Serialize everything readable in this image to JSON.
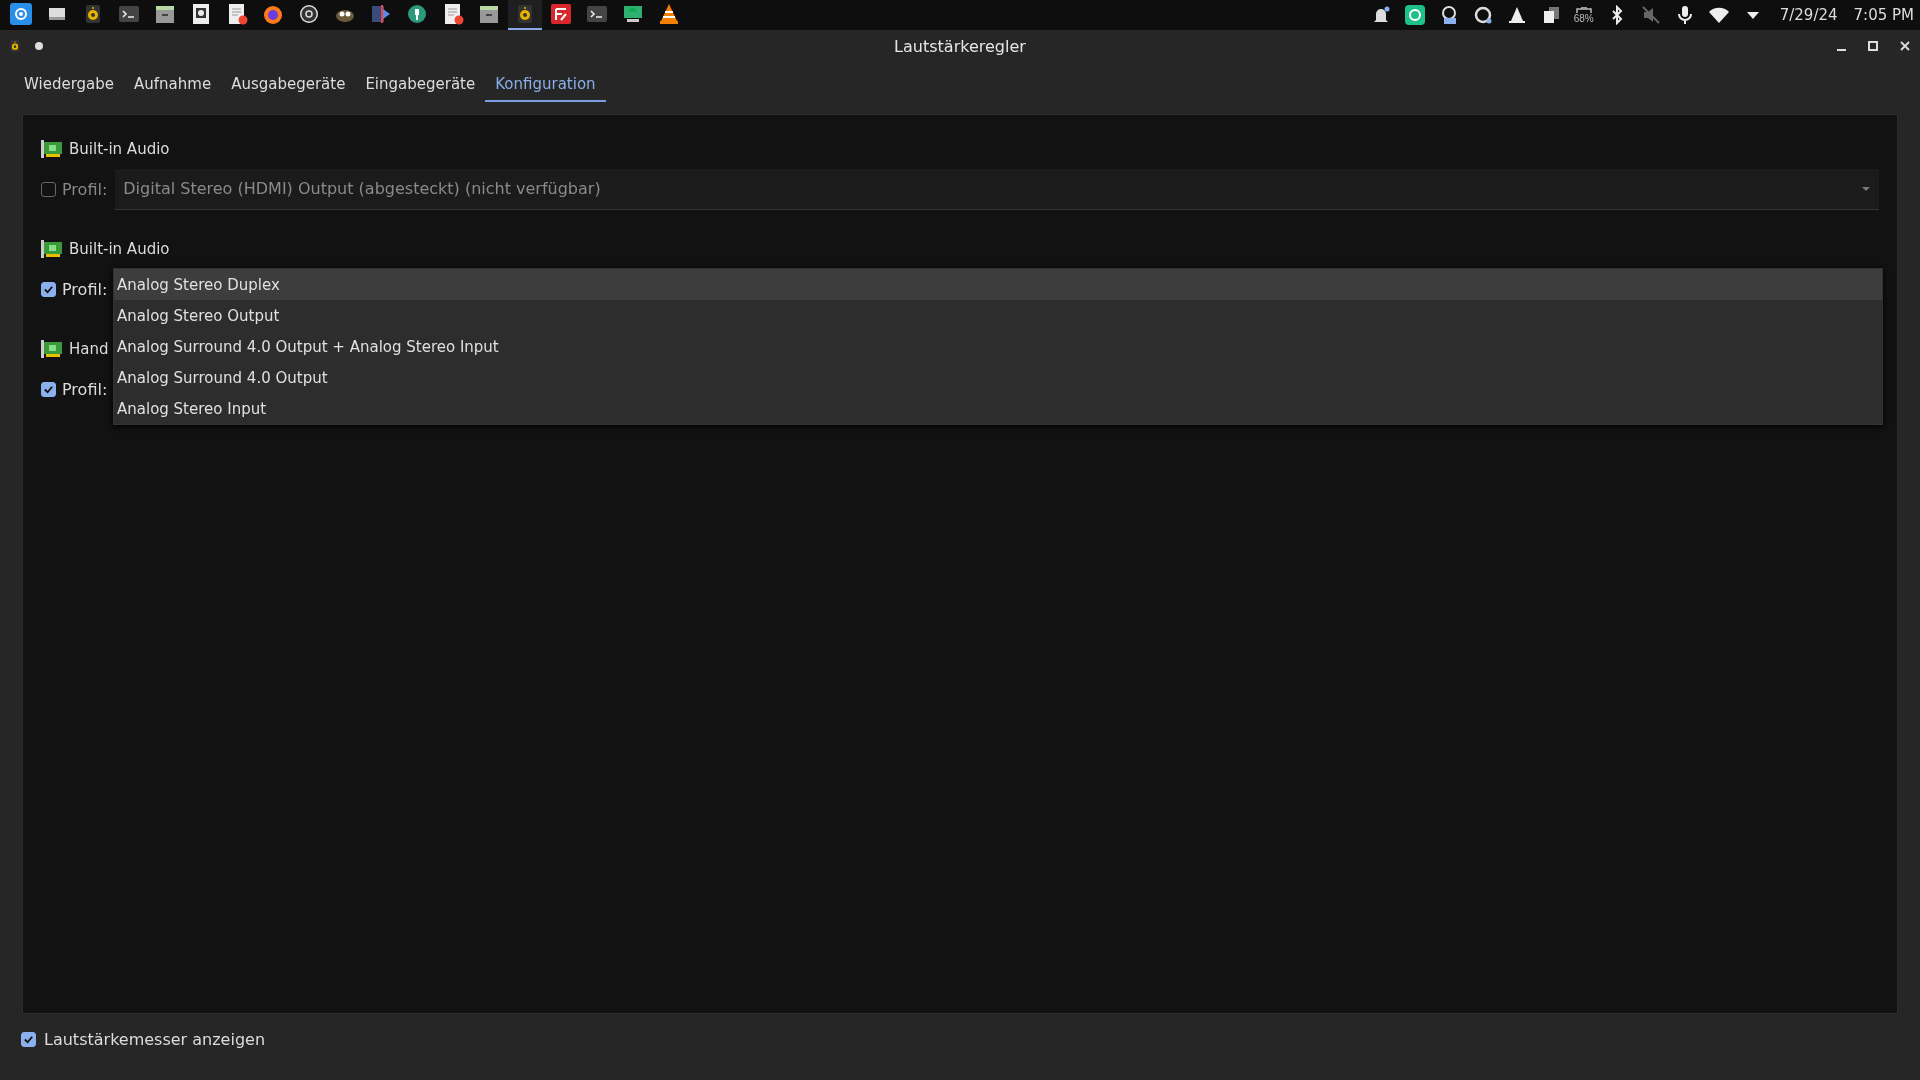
{
  "taskbar": {
    "tasks": [
      {
        "kind": "launcher",
        "selected": false
      },
      {
        "kind": "window",
        "selected": false
      },
      {
        "kind": "speaker",
        "selected": false
      },
      {
        "kind": "terminal",
        "selected": false
      },
      {
        "kind": "files",
        "selected": false
      },
      {
        "kind": "kde",
        "selected": false
      },
      {
        "kind": "editor",
        "selected": false
      },
      {
        "kind": "firefox",
        "selected": false
      },
      {
        "kind": "obs",
        "selected": false
      },
      {
        "kind": "gimp",
        "selected": false
      },
      {
        "kind": "video",
        "selected": false
      },
      {
        "kind": "wrench",
        "selected": false
      },
      {
        "kind": "editor",
        "selected": false
      },
      {
        "kind": "files",
        "selected": false
      },
      {
        "kind": "speaker",
        "selected": true
      },
      {
        "kind": "filezilla",
        "selected": false
      },
      {
        "kind": "terminal",
        "selected": false
      },
      {
        "kind": "android",
        "selected": false
      },
      {
        "kind": "vlc",
        "selected": false
      }
    ],
    "tray": [
      {
        "kind": "bell"
      },
      {
        "kind": "sync-app"
      },
      {
        "kind": "rec"
      },
      {
        "kind": "sync"
      },
      {
        "kind": "vlc"
      },
      {
        "kind": "clipboard"
      },
      {
        "kind": "battery",
        "text": "68%"
      },
      {
        "kind": "bluetooth"
      },
      {
        "kind": "muted"
      },
      {
        "kind": "mic"
      },
      {
        "kind": "wifi"
      },
      {
        "kind": "expand"
      }
    ],
    "date": "7/29/24",
    "time": "7:05 PM"
  },
  "window": {
    "title": "Lautstärkeregler"
  },
  "tabs": [
    {
      "label": "Wiedergabe",
      "selected": false
    },
    {
      "label": "Aufnahme",
      "selected": false
    },
    {
      "label": "Ausgabegeräte",
      "selected": false
    },
    {
      "label": "Eingabegeräte",
      "selected": false
    },
    {
      "label": "Konfiguration",
      "selected": true
    }
  ],
  "cards": [
    {
      "name": "Built-in Audio",
      "profile_label": "Profil:",
      "checked": false,
      "profile": "Digital Stereo (HDMI) Output (abgesteckt) (nicht verfügbar)"
    },
    {
      "name": "Built-in Audio",
      "profile_label": "Profil:",
      "checked": true
    },
    {
      "name": "Hand",
      "profile_label": "Profil:",
      "checked": true
    }
  ],
  "dropdown": {
    "options": [
      {
        "label": "Analog Stereo Duplex",
        "selected": true
      },
      {
        "label": "Analog Stereo Output",
        "selected": false
      },
      {
        "label": "Analog Surround 4.0 Output + Analog Stereo Input",
        "selected": false
      },
      {
        "label": "Analog Surround 4.0 Output",
        "selected": false
      },
      {
        "label": "Analog Stereo Input",
        "selected": false
      }
    ]
  },
  "footer": {
    "label": "Lautstärkemesser anzeigen",
    "checked": true
  }
}
